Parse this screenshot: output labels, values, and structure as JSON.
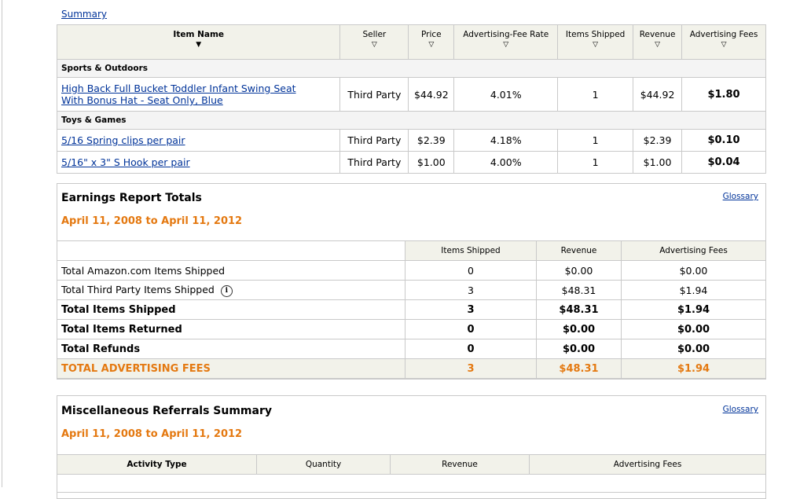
{
  "summary_link": "Summary",
  "items_table": {
    "headers": {
      "item_name": "Item Name",
      "seller": "Seller",
      "price": "Price",
      "fee_rate": "Advertising-Fee Rate",
      "items_shipped": "Items Shipped",
      "revenue": "Revenue",
      "advertising_fees": "Advertising Fees"
    },
    "sort_arrow_filled": "▼",
    "sort_arrow_open": "▽",
    "categories": [
      {
        "name": "Sports & Outdoors",
        "items": [
          {
            "name_line1": "High Back Full Bucket Toddler Infant Swing Seat",
            "name_line2": "With Bonus Hat - Seat Only, Blue",
            "seller": "Third Party",
            "price": "$44.92",
            "fee_rate": "4.01%",
            "shipped": "1",
            "revenue": "$44.92",
            "fees": "$1.80"
          }
        ]
      },
      {
        "name": "Toys & Games",
        "items": [
          {
            "name": "5/16 Spring clips per pair",
            "seller": "Third Party",
            "price": "$2.39",
            "fee_rate": "4.18%",
            "shipped": "1",
            "revenue": "$2.39",
            "fees": "$0.10"
          },
          {
            "name": "5/16\" x 3\" S Hook per pair",
            "seller": "Third Party",
            "price": "$1.00",
            "fee_rate": "4.00%",
            "shipped": "1",
            "revenue": "$1.00",
            "fees": "$0.04"
          }
        ]
      }
    ]
  },
  "earnings": {
    "title": "Earnings Report Totals",
    "glossary": "Glossary",
    "date_range": "April 11, 2008 to April 11, 2012",
    "headers": {
      "items_shipped": "Items Shipped",
      "revenue": "Revenue",
      "advertising_fees": "Advertising Fees"
    },
    "info_icon": "i",
    "rows": [
      {
        "label": "Total Amazon.com Items Shipped",
        "shipped": "0",
        "revenue": "$0.00",
        "fees": "$0.00"
      },
      {
        "label": "Total Third Party Items Shipped",
        "shipped": "3",
        "revenue": "$48.31",
        "fees": "$1.94"
      },
      {
        "label": "Total Items Shipped",
        "shipped": "3",
        "revenue": "$48.31",
        "fees": "$1.94"
      },
      {
        "label": "Total Items Returned",
        "shipped": "0",
        "revenue": "$0.00",
        "fees": "$0.00"
      },
      {
        "label": "Total Refunds",
        "shipped": "0",
        "revenue": "$0.00",
        "fees": "$0.00"
      },
      {
        "label": "TOTAL ADVERTISING FEES",
        "shipped": "3",
        "revenue": "$48.31",
        "fees": "$1.94"
      }
    ]
  },
  "misc": {
    "title": "Miscellaneous Referrals Summary",
    "glossary": "Glossary",
    "date_range": "April 11, 2008 to April 11, 2012",
    "headers": {
      "activity_type": "Activity Type",
      "quantity": "Quantity",
      "revenue": "Revenue",
      "advertising_fees": "Advertising Fees"
    }
  },
  "colors": {
    "accent_orange": "#e47911",
    "link_blue": "#003399",
    "header_bg": "#f2f2ea"
  }
}
